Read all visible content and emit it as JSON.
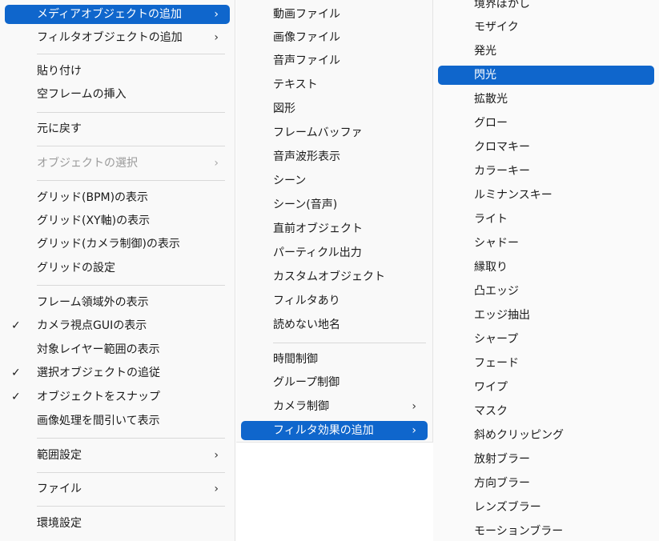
{
  "menu1": {
    "items": [
      {
        "label": "メディアオブジェクトの追加",
        "arrow": "›"
      },
      {
        "label": "フィルタオブジェクトの追加",
        "arrow": "›"
      },
      {
        "label": "貼り付け"
      },
      {
        "label": "空フレームの挿入"
      },
      {
        "label": "元に戻す"
      },
      {
        "label": "オブジェクトの選択",
        "arrow": "›"
      },
      {
        "label": "グリッド(BPM)の表示"
      },
      {
        "label": "グリッド(XY軸)の表示"
      },
      {
        "label": "グリッド(カメラ制御)の表示"
      },
      {
        "label": "グリッドの設定"
      },
      {
        "label": "フレーム領域外の表示"
      },
      {
        "label": "カメラ視点GUIの表示",
        "check": "✓"
      },
      {
        "label": "対象レイヤー範囲の表示"
      },
      {
        "label": "選択オブジェクトの追従",
        "check": "✓"
      },
      {
        "label": "オブジェクトをスナップ",
        "check": "✓"
      },
      {
        "label": "画像処理を間引いて表示"
      },
      {
        "label": "範囲設定",
        "arrow": "›"
      },
      {
        "label": "ファイル",
        "arrow": "›"
      },
      {
        "label": "環境設定"
      }
    ]
  },
  "menu2": {
    "items": [
      {
        "label": "動画ファイル"
      },
      {
        "label": "画像ファイル"
      },
      {
        "label": "音声ファイル"
      },
      {
        "label": "テキスト"
      },
      {
        "label": "図形"
      },
      {
        "label": "フレームバッファ"
      },
      {
        "label": "音声波形表示"
      },
      {
        "label": "シーン"
      },
      {
        "label": "シーン(音声)"
      },
      {
        "label": "直前オブジェクト"
      },
      {
        "label": "パーティクル出力"
      },
      {
        "label": "カスタムオブジェクト"
      },
      {
        "label": "フィルタあり"
      },
      {
        "label": "読めない地名"
      },
      {
        "label": "時間制御"
      },
      {
        "label": "グループ制御"
      },
      {
        "label": "カメラ制御",
        "arrow": "›"
      },
      {
        "label": "フィルタ効果の追加",
        "arrow": "›"
      }
    ]
  },
  "menu3": {
    "items": [
      {
        "label": "境界ぼかし"
      },
      {
        "label": "モザイク"
      },
      {
        "label": "発光"
      },
      {
        "label": "閃光"
      },
      {
        "label": "拡散光"
      },
      {
        "label": "グロー"
      },
      {
        "label": "クロマキー"
      },
      {
        "label": "カラーキー"
      },
      {
        "label": "ルミナンスキー"
      },
      {
        "label": "ライト"
      },
      {
        "label": "シャドー"
      },
      {
        "label": "縁取り"
      },
      {
        "label": "凸エッジ"
      },
      {
        "label": "エッジ抽出"
      },
      {
        "label": "シャープ"
      },
      {
        "label": "フェード"
      },
      {
        "label": "ワイプ"
      },
      {
        "label": "マスク"
      },
      {
        "label": "斜めクリッピング"
      },
      {
        "label": "放射ブラー"
      },
      {
        "label": "方向ブラー"
      },
      {
        "label": "レンズブラー"
      },
      {
        "label": "モーションブラー"
      }
    ]
  },
  "colors": {
    "selected": "#0f66cc",
    "menu_background": "#f9f9f9",
    "disabled_text": "#9a9a9a"
  }
}
